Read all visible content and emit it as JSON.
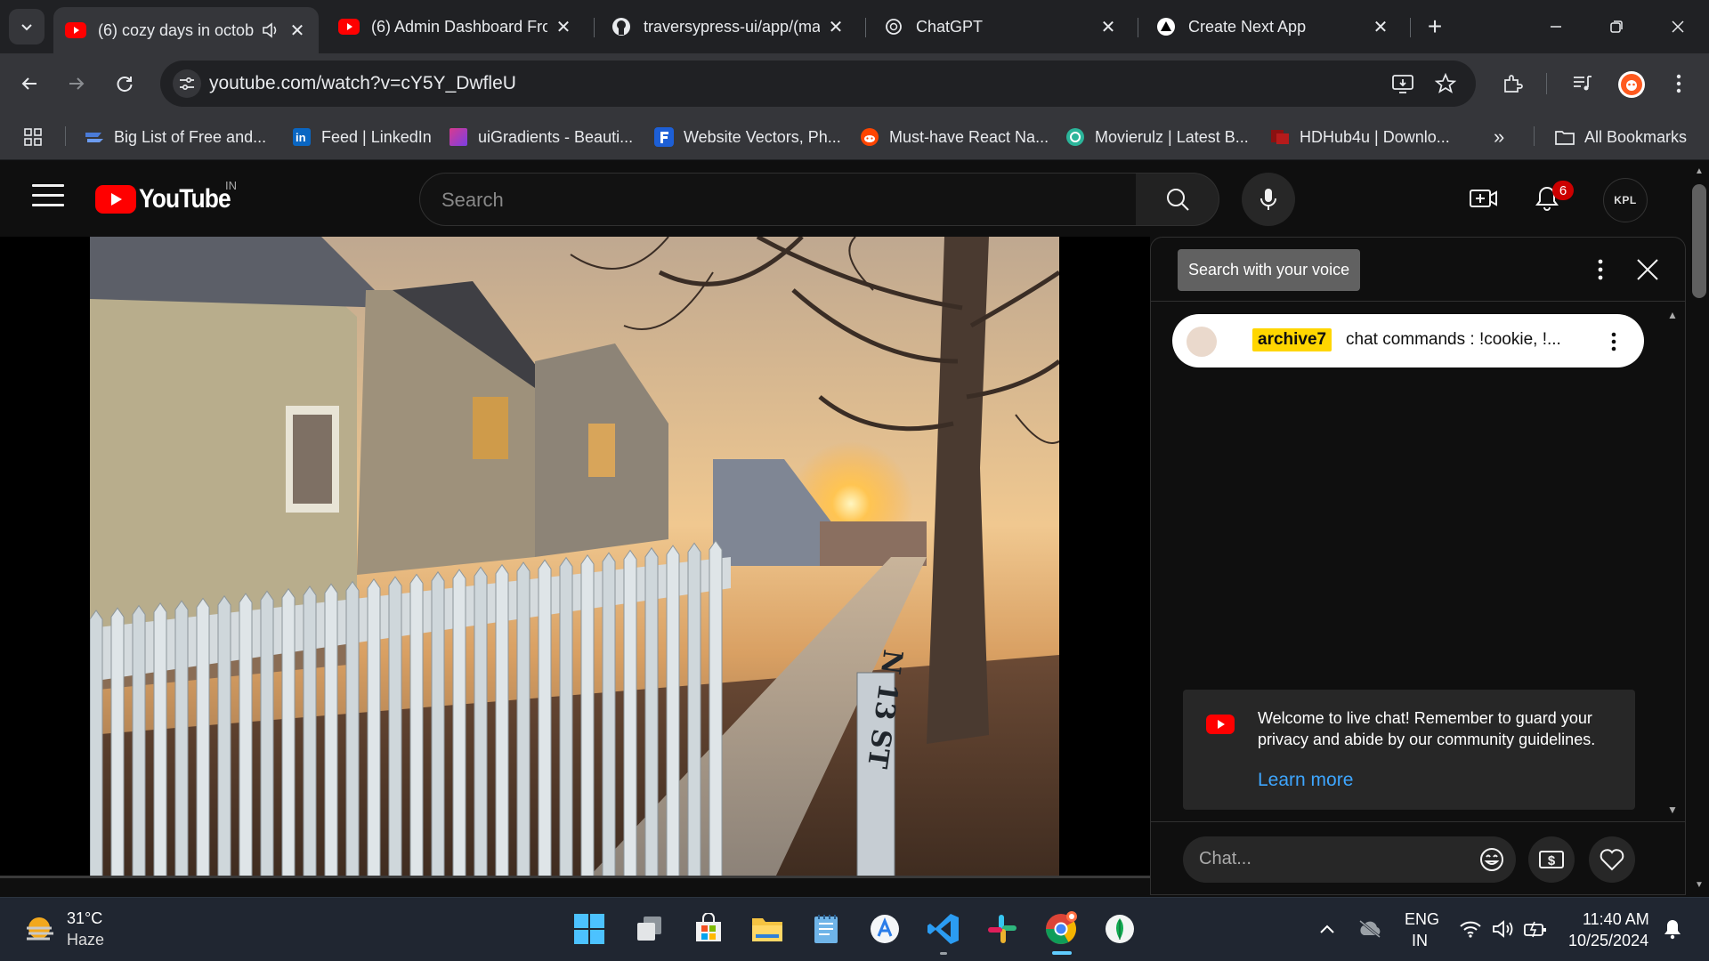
{
  "browser": {
    "tabs": [
      {
        "title": "(6) cozy days in octob",
        "favicon": "youtube-icon",
        "active": true,
        "audio": true
      },
      {
        "title": "(6) Admin Dashboard Fro",
        "favicon": "youtube-icon",
        "active": false
      },
      {
        "title": "traversypress-ui/app/(ma",
        "favicon": "github-icon",
        "active": false
      },
      {
        "title": "ChatGPT",
        "favicon": "chatgpt-icon",
        "active": false
      },
      {
        "title": "Create Next App",
        "favicon": "nextjs-icon",
        "active": false
      }
    ],
    "url": "youtube.com/watch?v=cY5Y_DwfleU",
    "bookmarks": [
      {
        "label": "Big List of Free and...",
        "favicon": "bookmark-list-icon"
      },
      {
        "label": "Feed | LinkedIn",
        "favicon": "linkedin-icon"
      },
      {
        "label": "uiGradients - Beauti...",
        "favicon": "uigradients-icon"
      },
      {
        "label": "Website Vectors, Ph...",
        "favicon": "freepik-icon"
      },
      {
        "label": "Must-have React Na...",
        "favicon": "reddit-icon"
      },
      {
        "label": "Movierulz | Latest B...",
        "favicon": "movierulz-icon"
      },
      {
        "label": "HDHub4u | Downlo...",
        "favicon": "hdhub-icon"
      }
    ],
    "bookmarks_overflow": "»",
    "all_bookmarks_label": "All Bookmarks"
  },
  "youtube": {
    "logo_text": "YouTube",
    "country_code": "IN",
    "search_placeholder": "Search",
    "notification_count": "6",
    "avatar_text": "KPL"
  },
  "video": {
    "sign_text": "N 13 ST"
  },
  "chat": {
    "tooltip": "Search with your voice",
    "pinned_author": "archive7",
    "pinned_message": "chat commands : !cookie, !...",
    "welcome_text": "Welcome to live chat! Remember to guard your privacy and abide by our community guidelines.",
    "learn_more": "Learn more",
    "input_placeholder": "Chat..."
  },
  "taskbar": {
    "weather_temp": "31°C",
    "weather_desc": "Haze",
    "lang_primary": "ENG",
    "lang_secondary": "IN",
    "time": "11:40 AM",
    "date": "10/25/2024"
  },
  "colors": {
    "youtube_red": "#ff0000",
    "link_blue": "#3ea6ff",
    "author_highlight": "#ffd600",
    "taskbar_bg": "#202631"
  }
}
